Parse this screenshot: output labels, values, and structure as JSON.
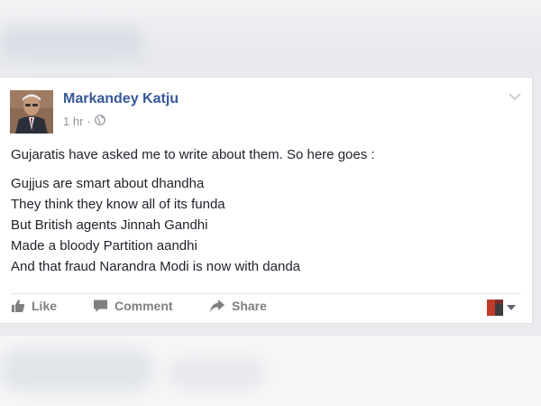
{
  "post": {
    "author": "Markandey Katju",
    "time": "1 hr",
    "separator": "·",
    "privacy_icon": "globe-icon",
    "menu_icon": "chevron-down-icon",
    "intro": "Gujaratis have asked me to write about them. So here goes :",
    "lines": [
      "Gujjus are smart about dhandha",
      "They think they know all of its funda",
      "But British agents Jinnah Gandhi",
      "Made a bloody Partition aandhi",
      "And that fraud Narandra Modi is now with danda"
    ]
  },
  "actions": {
    "like_label": "Like",
    "comment_label": "Comment",
    "share_label": "Share"
  },
  "colors": {
    "author_link": "#365899",
    "action_text": "#7f7f7f",
    "body_text": "#1d2129",
    "meta_text": "#90949c"
  }
}
